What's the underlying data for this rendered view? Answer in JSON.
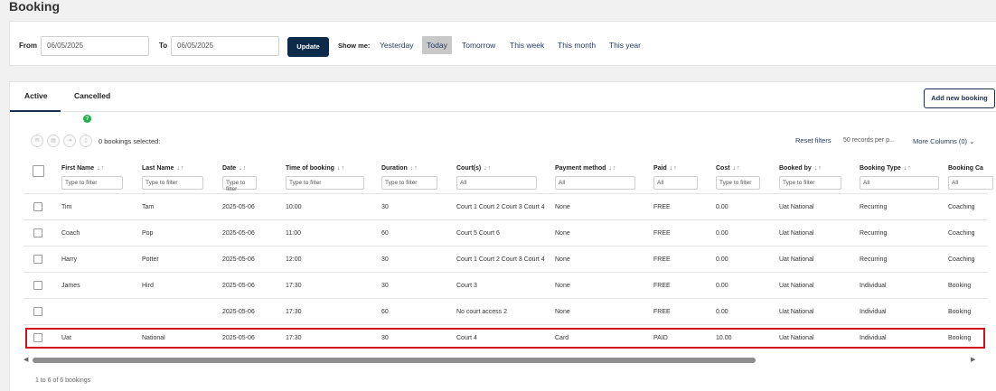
{
  "page": {
    "title": "Booking"
  },
  "filters": {
    "from_label": "From",
    "from_value": "06/05/2025",
    "to_label": "To",
    "to_value": "06/05/2025",
    "update_label": "Update",
    "show_me_label": "Show me:",
    "ranges": [
      "Yesterday",
      "Today",
      "Tomorrow",
      "This week",
      "This month",
      "This year"
    ],
    "selected_range": "Today"
  },
  "tabs": {
    "active": "Active",
    "cancelled": "Cancelled"
  },
  "add_button": "Add new booking",
  "help_icon_glyph": "?",
  "toolbar": {
    "icons": [
      "email-icon",
      "print-icon",
      "export-icon",
      "delete-icon"
    ],
    "selected_text": "0 bookings selected:",
    "reset_filters": "Reset filters",
    "per_page": "50 records per p...",
    "more_columns": "More Columns (0)"
  },
  "columns": [
    {
      "label": "First Name",
      "filter": "Type to filter"
    },
    {
      "label": "Last Name",
      "filter": "Type to filter"
    },
    {
      "label": "Date",
      "filter": "Type to filter"
    },
    {
      "label": "Time of booking",
      "filter": "Type to filter"
    },
    {
      "label": "Duration",
      "filter": "Type to filter"
    },
    {
      "label": "Court(s)",
      "filter": "All"
    },
    {
      "label": "Payment method",
      "filter": "All"
    },
    {
      "label": "Paid",
      "filter": "All"
    },
    {
      "label": "Cost",
      "filter": "Type to filter"
    },
    {
      "label": "Booked by",
      "filter": "Type to filter"
    },
    {
      "label": "Booking Type",
      "filter": "All"
    },
    {
      "label": "Booking Ca",
      "filter": "All"
    }
  ],
  "rows": [
    [
      "Tim",
      "Tam",
      "2025-05-06",
      "10:00",
      "30",
      "Court 1 Court 2 Court 3 Court 4",
      "None",
      "FREE",
      "0.00",
      "Uat National",
      "Recurring",
      "Coaching"
    ],
    [
      "Coach",
      "Pop",
      "2025-05-06",
      "11:00",
      "60",
      "Court 5 Court 6",
      "None",
      "FREE",
      "0.00",
      "Uat National",
      "Recurring",
      "Coaching"
    ],
    [
      "Harry",
      "Potter",
      "2025-05-06",
      "12:00",
      "30",
      "Court 1 Court 2 Court 3 Court 4",
      "None",
      "FREE",
      "0.00",
      "Uat National",
      "Recurring",
      "Coaching"
    ],
    [
      "James",
      "Hird",
      "2025-05-06",
      "17:30",
      "30",
      "Court 3",
      "None",
      "FREE",
      "0.00",
      "Uat National",
      "Individual",
      "Booking"
    ],
    [
      "",
      "",
      "2025-05-06",
      "17:30",
      "60",
      "No court access 2",
      "None",
      "FREE",
      "0.00",
      "Uat National",
      "Individual",
      "Booking"
    ],
    [
      "Uat",
      "National",
      "2025-05-06",
      "17:30",
      "30",
      "Court 4",
      "Card",
      "PAID",
      "10.00",
      "Uat National",
      "Individual",
      "Booking"
    ]
  ],
  "highlighted_row": 5,
  "highlight_color": "#d0101e",
  "footer": "1 to 6 of 6 bookings"
}
